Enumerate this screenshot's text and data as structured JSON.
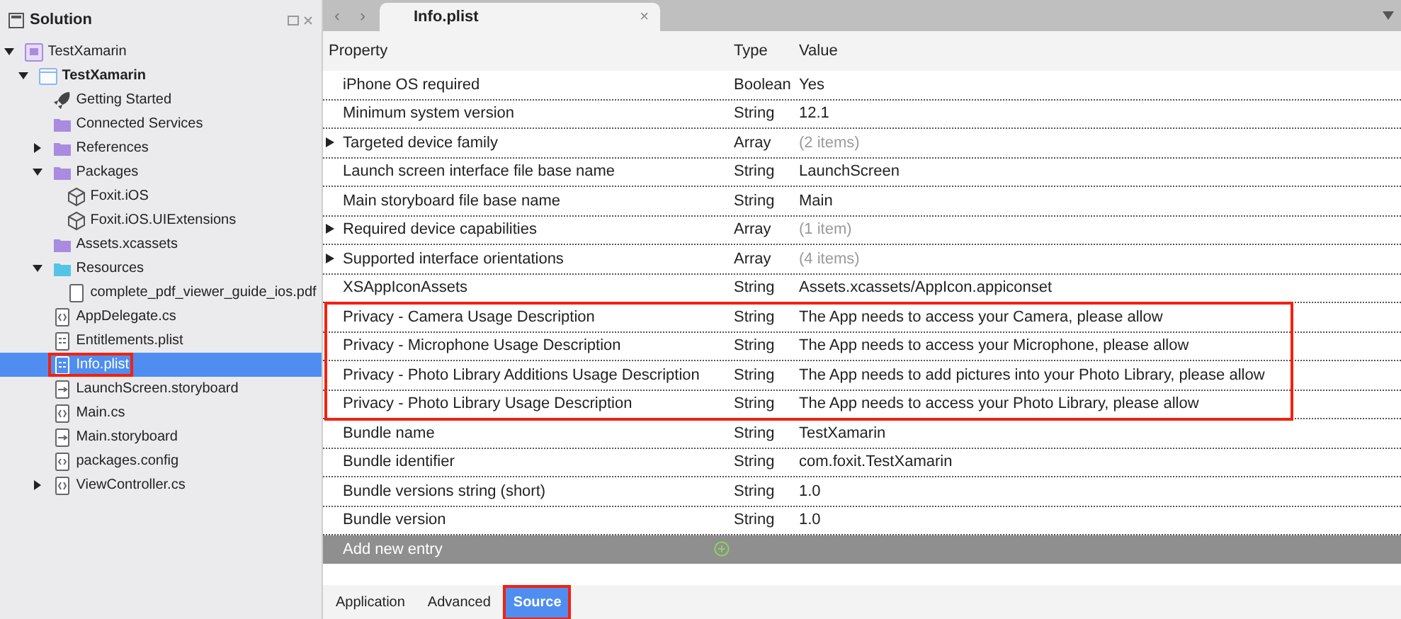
{
  "sidebar": {
    "title": "Solution",
    "tree": [
      {
        "label": "TestXamarin",
        "kind": "solution",
        "expanded": true,
        "children": [
          {
            "label": "TestXamarin",
            "kind": "project",
            "bold": true,
            "expanded": true,
            "children": [
              {
                "label": "Getting Started",
                "kind": "rocket"
              },
              {
                "label": "Connected Services",
                "kind": "folder-purple"
              },
              {
                "label": "References",
                "kind": "folder-purple",
                "expanded": false
              },
              {
                "label": "Packages",
                "kind": "folder-purple",
                "expanded": true,
                "children": [
                  {
                    "label": "Foxit.iOS",
                    "kind": "package"
                  },
                  {
                    "label": "Foxit.iOS.UIExtensions",
                    "kind": "package"
                  }
                ]
              },
              {
                "label": "Assets.xcassets",
                "kind": "folder-purple"
              },
              {
                "label": "Resources",
                "kind": "folder-blue",
                "expanded": true,
                "children": [
                  {
                    "label": "complete_pdf_viewer_guide_ios.pdf",
                    "kind": "file"
                  }
                ]
              },
              {
                "label": "AppDelegate.cs",
                "kind": "code"
              },
              {
                "label": "Entitlements.plist",
                "kind": "plist"
              },
              {
                "label": "Info.plist",
                "kind": "plist",
                "selected": true,
                "annotated": true
              },
              {
                "label": "LaunchScreen.storyboard",
                "kind": "storyboard"
              },
              {
                "label": "Main.cs",
                "kind": "code"
              },
              {
                "label": "Main.storyboard",
                "kind": "storyboard"
              },
              {
                "label": "packages.config",
                "kind": "config"
              },
              {
                "label": "ViewController.cs",
                "kind": "code",
                "expanded": false
              }
            ]
          }
        ]
      }
    ]
  },
  "editor": {
    "nav": [
      "‹",
      "›"
    ],
    "tab": "Info.plist",
    "tab_close": "×",
    "columns": [
      "Property",
      "Type",
      "Value"
    ],
    "rows": [
      {
        "property": "iPhone OS required",
        "type": "Boolean",
        "value": "Yes",
        "kind": "value",
        "annotated": false
      },
      {
        "property": "Minimum system version",
        "type": "String",
        "value": "12.1",
        "kind": "value",
        "annotated": false
      },
      {
        "property": "Targeted device family",
        "type": "Array",
        "value": "(2 items)",
        "kind": "array",
        "annotated": false
      },
      {
        "property": "Launch screen interface file base name",
        "type": "String",
        "value": "LaunchScreen",
        "kind": "value",
        "annotated": false
      },
      {
        "property": "Main storyboard file base name",
        "type": "String",
        "value": "Main",
        "kind": "value",
        "annotated": false
      },
      {
        "property": "Required device capabilities",
        "type": "Array",
        "value": "(1 item)",
        "kind": "array",
        "annotated": false
      },
      {
        "property": "Supported interface orientations",
        "type": "Array",
        "value": "(4 items)",
        "kind": "array",
        "annotated": false
      },
      {
        "property": "XSAppIconAssets",
        "type": "String",
        "value": "Assets.xcassets/AppIcon.appiconset",
        "kind": "value",
        "annotated": false
      },
      {
        "property": "Privacy - Camera Usage Description",
        "type": "String",
        "value": "The App needs to access your Camera, please allow",
        "kind": "value",
        "annotated": true
      },
      {
        "property": "Privacy - Microphone Usage Description",
        "type": "String",
        "value": "The App needs to access your Microphone, please allow",
        "kind": "value",
        "annotated": true
      },
      {
        "property": "Privacy - Photo Library Additions Usage Description",
        "type": "String",
        "value": "The App needs to add pictures into your Photo Library, please allow",
        "kind": "value",
        "annotated": true
      },
      {
        "property": "Privacy - Photo Library Usage Description",
        "type": "String",
        "value": "The App needs to access your Photo Library, please allow",
        "kind": "value",
        "annotated": true
      },
      {
        "property": "Bundle name",
        "type": "String",
        "value": "TestXamarin",
        "kind": "value",
        "annotated": false
      },
      {
        "property": "Bundle identifier",
        "type": "String",
        "value": "com.foxit.TestXamarin",
        "kind": "value",
        "annotated": false
      },
      {
        "property": "Bundle versions string (short)",
        "type": "String",
        "value": "1.0",
        "kind": "value",
        "annotated": false
      },
      {
        "property": "Bundle version",
        "type": "String",
        "value": "1.0",
        "kind": "value",
        "annotated": false
      }
    ],
    "add_entry": {
      "placeholder": "Add new entry"
    },
    "bottom_tabs": [
      {
        "label": "Application",
        "selected": false,
        "annotated": false
      },
      {
        "label": "Advanced",
        "selected": false,
        "annotated": false
      },
      {
        "label": "Source",
        "selected": true,
        "annotated": true
      }
    ]
  }
}
